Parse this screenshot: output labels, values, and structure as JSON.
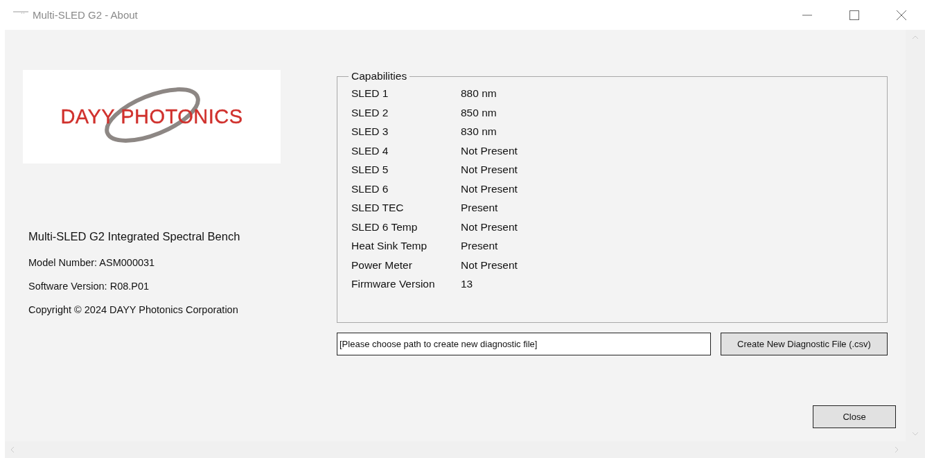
{
  "window": {
    "title": "Multi-SLED G2 - About"
  },
  "logo": {
    "text": "DAYY PHOTONICS"
  },
  "product": {
    "name": "Multi-SLED G2 Integrated Spectral Bench",
    "model": "Model Number: ASM000031",
    "software": "Software Version: R08.P01",
    "copyright": "Copyright © 2024 DAYY Photonics Corporation"
  },
  "capabilities": {
    "title": "Capabilities",
    "rows": [
      {
        "label": "SLED 1",
        "value": "880 nm"
      },
      {
        "label": "SLED 2",
        "value": "850 nm"
      },
      {
        "label": "SLED 3",
        "value": "830 nm"
      },
      {
        "label": "SLED 4",
        "value": "Not Present"
      },
      {
        "label": "SLED 5",
        "value": "Not Present"
      },
      {
        "label": "SLED 6",
        "value": "Not Present"
      },
      {
        "label": "SLED TEC",
        "value": "Present"
      },
      {
        "label": "SLED  6 Temp",
        "value": "Not Present"
      },
      {
        "label": "Heat Sink Temp",
        "value": "Present"
      },
      {
        "label": "Power Meter",
        "value": "Not Present"
      },
      {
        "label": "Firmware Version",
        "value": "13"
      }
    ]
  },
  "diagnostic": {
    "path_value": "[Please choose path to create new diagnostic file]",
    "button": "Create New Diagnostic File (.csv)"
  },
  "buttons": {
    "close": "Close"
  }
}
